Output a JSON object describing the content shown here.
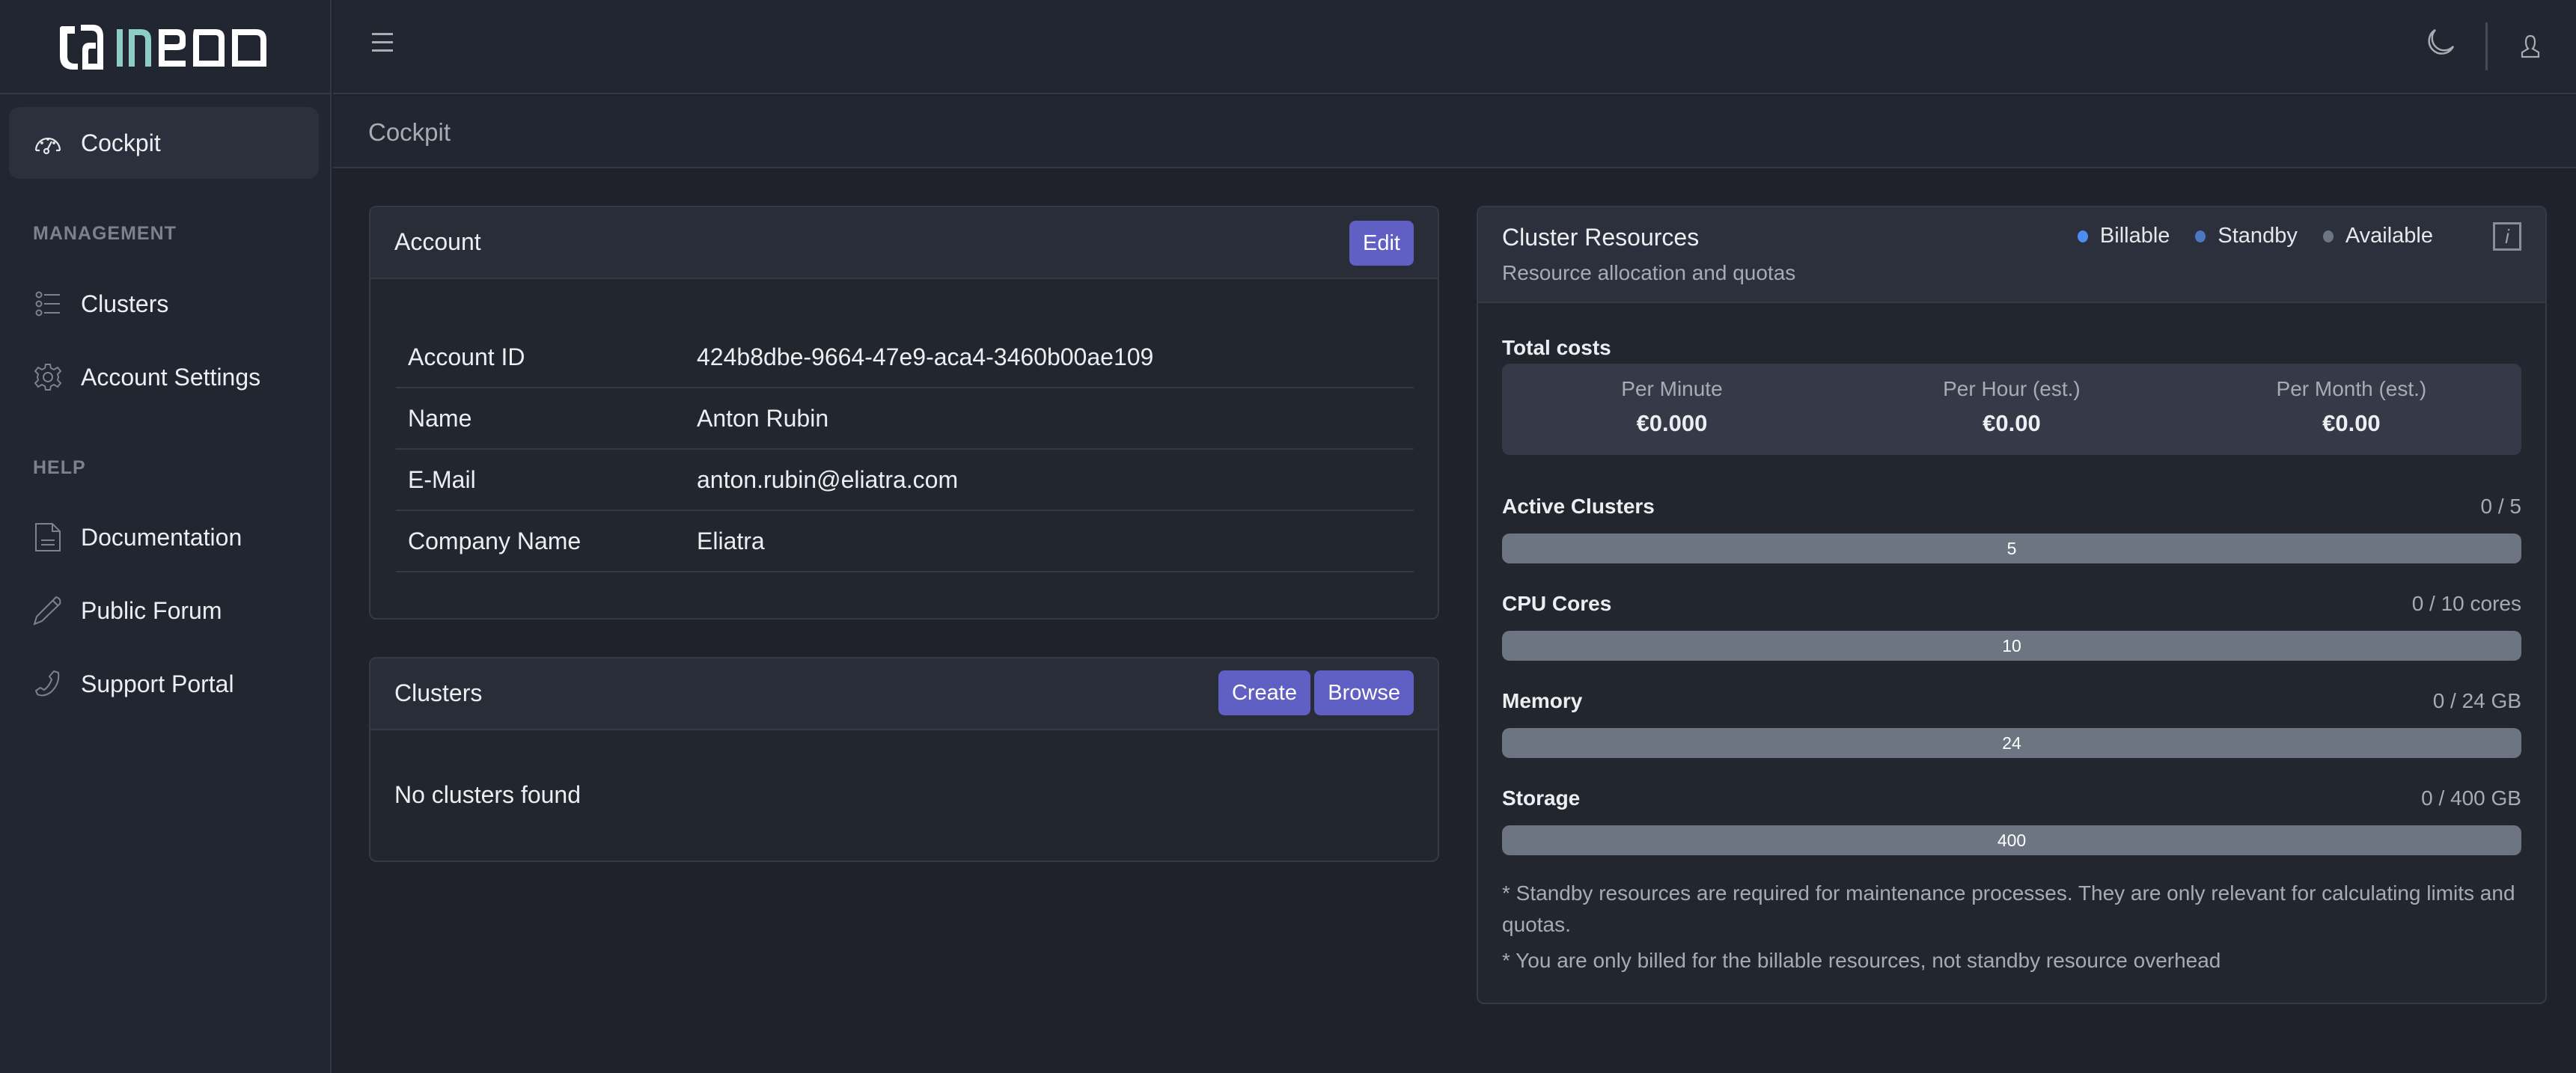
{
  "app": {
    "logo_text": "meod"
  },
  "sidebar": {
    "active": "Cockpit",
    "items": [
      {
        "label": "Cockpit",
        "icon": "gauge-icon"
      }
    ],
    "sections": [
      {
        "title": "MANAGEMENT",
        "items": [
          {
            "label": "Clusters",
            "icon": "list-icon"
          },
          {
            "label": "Account Settings",
            "icon": "gear-icon"
          }
        ]
      },
      {
        "title": "HELP",
        "items": [
          {
            "label": "Documentation",
            "icon": "document-icon"
          },
          {
            "label": "Public Forum",
            "icon": "pencil-icon"
          },
          {
            "label": "Support Portal",
            "icon": "phone-icon"
          }
        ]
      }
    ]
  },
  "header": {
    "menu_icon": "hamburger-icon",
    "theme_icon": "moon-icon",
    "user_icon": "user-icon"
  },
  "breadcrumb": "Cockpit",
  "account_card": {
    "title": "Account",
    "edit_label": "Edit",
    "rows": [
      {
        "key": "Account ID",
        "value": "424b8dbe-9664-47e9-aca4-3460b00ae109"
      },
      {
        "key": "Name",
        "value": "Anton Rubin"
      },
      {
        "key": "E-Mail",
        "value": "anton.rubin@eliatra.com"
      },
      {
        "key": "Company Name",
        "value": "Eliatra"
      }
    ]
  },
  "clusters_card": {
    "title": "Clusters",
    "create_label": "Create",
    "browse_label": "Browse",
    "empty_text": "No clusters found"
  },
  "resources_card": {
    "title": "Cluster Resources",
    "subtitle": "Resource allocation and quotas",
    "legend": [
      {
        "label": "Billable",
        "color": "#4b8df2"
      },
      {
        "label": "Standby",
        "color": "#4a78c4"
      },
      {
        "label": "Available",
        "color": "#6c7581"
      }
    ],
    "info_icon": "info-icon",
    "total_costs_label": "Total costs",
    "costs": [
      {
        "label": "Per Minute",
        "value": "€0.000"
      },
      {
        "label": "Per Hour (est.)",
        "value": "€0.00"
      },
      {
        "label": "Per Month (est.)",
        "value": "€0.00"
      }
    ],
    "resources": [
      {
        "label": "Active Clusters",
        "usage": "0 / 5",
        "bar_text": "5",
        "billable": 0,
        "standby": 0,
        "total": 5
      },
      {
        "label": "CPU Cores",
        "usage": "0 / 10 cores",
        "bar_text": "10",
        "billable": 0,
        "standby": 0,
        "total": 10
      },
      {
        "label": "Memory",
        "usage": "0 / 24 GB",
        "bar_text": "24",
        "billable": 0,
        "standby": 0,
        "total": 24
      },
      {
        "label": "Storage",
        "usage": "0 / 400 GB",
        "bar_text": "400",
        "billable": 0,
        "standby": 0,
        "total": 400
      }
    ],
    "notes": [
      "* Standby resources are required for maintenance processes. They are only relevant for calculating limits and quotas.",
      "* You are only billed for the billable resources, not standby resource overhead"
    ]
  }
}
